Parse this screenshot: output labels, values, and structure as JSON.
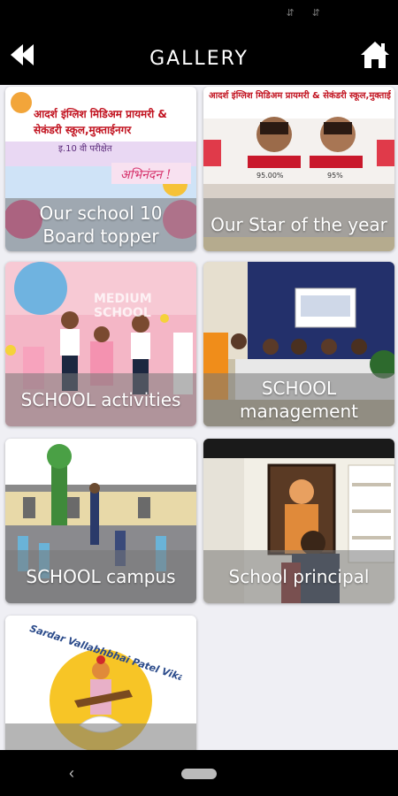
{
  "app": {
    "title": "GALLERY"
  },
  "icons": {
    "back": "double-chevron-left-icon",
    "home": "home-icon"
  },
  "colors": {
    "bar": "#000000",
    "content_bg": "#efeff4",
    "label_band": "rgba(120,120,120,0.55)"
  },
  "gallery": [
    {
      "label": "Our school 10 Board topper"
    },
    {
      "label": "Our Star of the year"
    },
    {
      "label": "SCHOOL activities"
    },
    {
      "label": "SCHOOL management"
    },
    {
      "label": "SCHOOL campus"
    },
    {
      "label": "School principal"
    },
    {
      "label": ""
    }
  ],
  "posters": {
    "topper_banner": "आदर्श इंग्लिश मिडिअम प्रायमरी & सेकंडरी स्कूल,मुक्ताईनगर",
    "topper_sub": "इ.10 वी परीक्षेत",
    "topper_congrats": "अभिनंदन !",
    "star_banner": "आदर्श इंग्लिश मिडिअम प्रायमरी & सेकंडरी स्कूल,मुक्ताई",
    "star_percent_1": "95.00%",
    "star_percent_2": "95%",
    "activities_banner": "MEDIUM SCHOOL",
    "logo_ring": "Sardar Vallabhbhai Patel Vikas Samanthe Sanchalit"
  }
}
